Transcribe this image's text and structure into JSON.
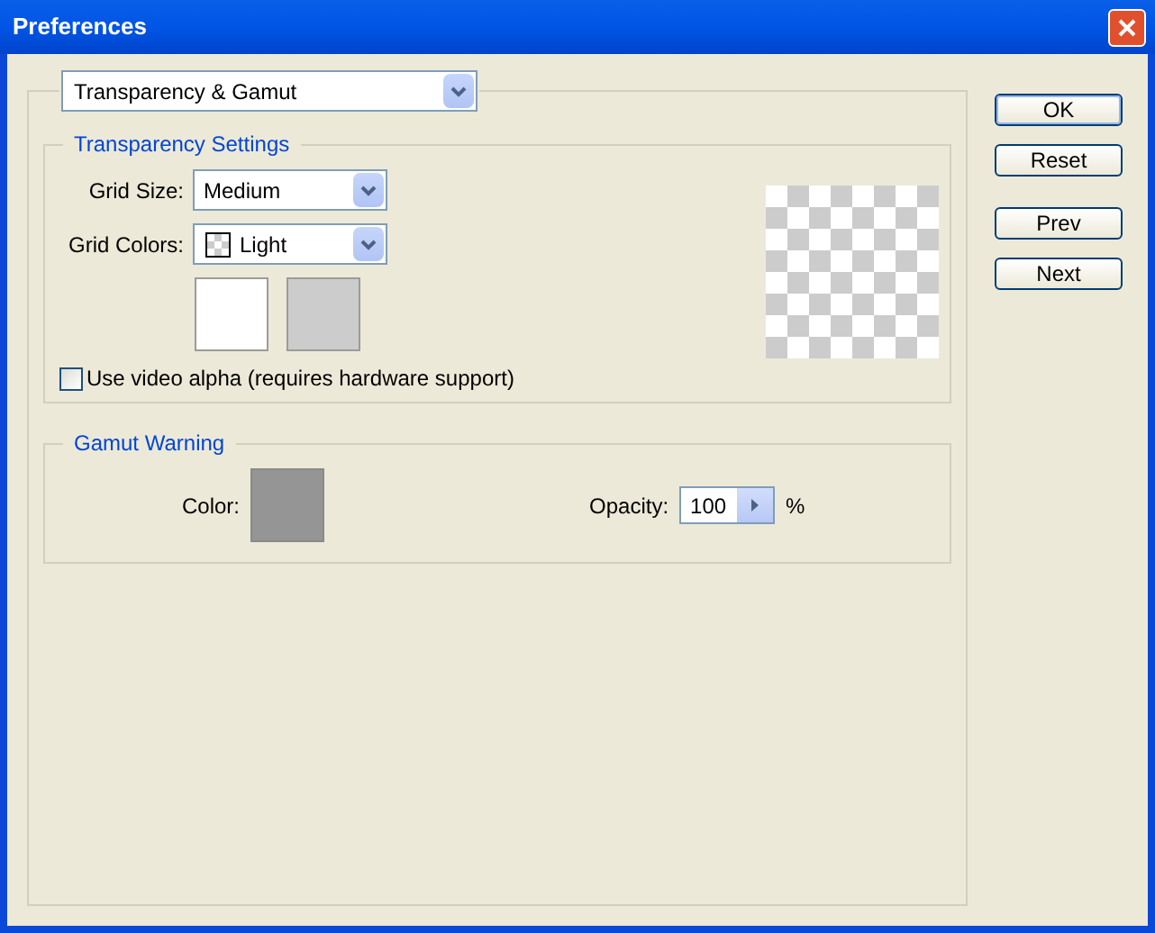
{
  "window": {
    "title": "Preferences"
  },
  "section_select": {
    "value": "Transparency & Gamut"
  },
  "transparency": {
    "title": "Transparency Settings",
    "grid_size": {
      "label": "Grid Size:",
      "value": "Medium"
    },
    "grid_colors": {
      "label": "Grid Colors:",
      "value": "Light"
    },
    "swatches": [
      {
        "color": "#ffffff"
      },
      {
        "color": "#cccccc"
      }
    ],
    "video_alpha": {
      "label": "Use video alpha (requires hardware support)",
      "checked": false
    }
  },
  "gamut": {
    "title": "Gamut Warning",
    "color_label": "Color:",
    "color": "#959595",
    "opacity_label": "Opacity:",
    "opacity": "100",
    "unit": "%"
  },
  "buttons": [
    {
      "label": "OK",
      "default": true
    },
    {
      "label": "Reset",
      "default": false
    },
    {
      "label": "Prev",
      "default": false
    },
    {
      "label": "Next",
      "default": false
    }
  ]
}
